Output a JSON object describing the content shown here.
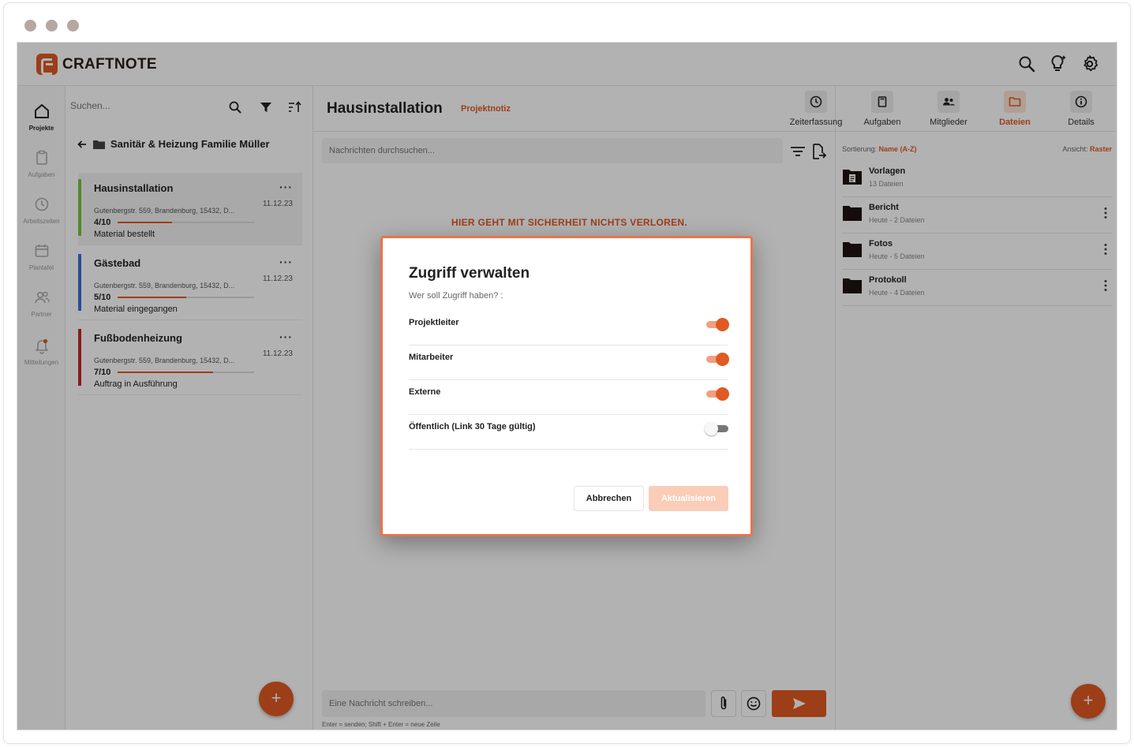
{
  "app": {
    "brand": "CRAFTNOTE"
  },
  "colors": {
    "accent": "#e05a23",
    "green": "#7cc243",
    "blue": "#3d6fd6",
    "red": "#c0272d"
  },
  "nav": [
    {
      "label": "Projekte",
      "icon": "home-icon",
      "active": true
    },
    {
      "label": "Aufgaben",
      "icon": "clipboard-icon"
    },
    {
      "label": "Arbeitszeiten",
      "icon": "clock-icon"
    },
    {
      "label": "Plantafel",
      "icon": "calendar-icon"
    },
    {
      "label": "Partner",
      "icon": "users-icon"
    },
    {
      "label": "Mitteilungen",
      "icon": "bell-icon"
    }
  ],
  "project_list": {
    "search_placeholder": "Suchen...",
    "breadcrumb": "Sanitär & Heizung Familie Müller",
    "projects": [
      {
        "title": "Hausinstallation",
        "date": "11.12.23",
        "address": "Gutenbergstr. 559, Brandenburg, 15432, D...",
        "count": "4/10",
        "progress": 0.4,
        "status": "Material bestellt",
        "color": "#7cc243"
      },
      {
        "title": "Gästebad",
        "date": "11.12.23",
        "address": "Gutenbergstr. 559, Brandenburg, 15432, D...",
        "count": "5/10",
        "progress": 0.5,
        "status": "Material eingegangen",
        "color": "#3d6fd6"
      },
      {
        "title": "Fußbodenheizung",
        "date": "11.12.23",
        "address": "Gutenbergstr. 559, Brandenburg, 15432, D...",
        "count": "7/10",
        "progress": 0.7,
        "status": "Auftrag in Ausführung",
        "color": "#c0272d"
      }
    ]
  },
  "main": {
    "title": "Hausinstallation",
    "subtitle": "Projektnotiz",
    "tabs": [
      {
        "label": "Zeiterfassung",
        "icon": "clock-icon"
      },
      {
        "label": "Aufgaben",
        "icon": "clipboard-icon"
      },
      {
        "label": "Mitglieder",
        "icon": "members-icon"
      },
      {
        "label": "Dateien",
        "icon": "folder-icon",
        "active": true
      },
      {
        "label": "Details",
        "icon": "info-icon"
      }
    ],
    "message_search_placeholder": "Nachrichten durchsuchen...",
    "banner": "HIER GEHT MIT SICHERHEIT NICHTS VERLOREN.",
    "composer_placeholder": "Eine Nachricht schreiben...",
    "hint": "Enter = senden; Shift + Enter = neue Zeile"
  },
  "files": {
    "sort_label": "Sortierung:",
    "sort_value": "Name (A-Z)",
    "view_label": "Ansicht:",
    "view_value": "Raster",
    "items": [
      {
        "name": "Vorlagen",
        "meta": "13 Dateien"
      },
      {
        "name": "Bericht",
        "meta": "Heute - 2 Dateien"
      },
      {
        "name": "Fotos",
        "meta": "Heute - 5 Dateien"
      },
      {
        "name": "Protokoll",
        "meta": "Heute - 4 Dateien"
      }
    ]
  },
  "modal": {
    "title": "Zugriff verwalten",
    "subtitle": "Wer soll Zugriff haben? :",
    "options": [
      {
        "label": "Projektleiter",
        "enabled": true
      },
      {
        "label": "Mitarbeiter",
        "enabled": true
      },
      {
        "label": "Externe",
        "enabled": true
      },
      {
        "label": "Öffentlich (Link 30 Tage gültig)",
        "enabled": false
      }
    ],
    "cancel_label": "Abbrechen",
    "update_label": "Aktualisieren"
  }
}
